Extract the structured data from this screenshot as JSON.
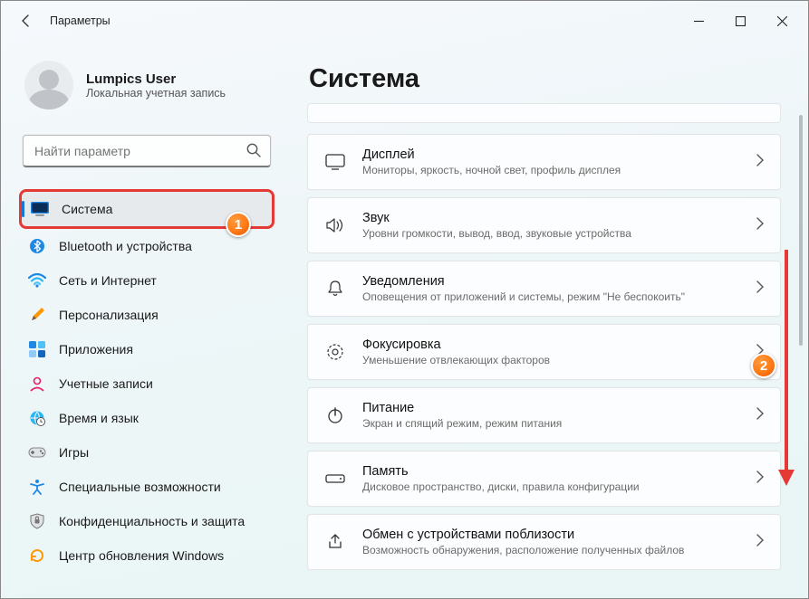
{
  "window": {
    "title": "Параметры"
  },
  "account": {
    "name": "Lumpics User",
    "type": "Локальная учетная запись"
  },
  "search": {
    "placeholder": "Найти параметр"
  },
  "sidebar": {
    "items": [
      {
        "label": "Система"
      },
      {
        "label": "Bluetooth и устройства"
      },
      {
        "label": "Сеть и Интернет"
      },
      {
        "label": "Персонализация"
      },
      {
        "label": "Приложения"
      },
      {
        "label": "Учетные записи"
      },
      {
        "label": "Время и язык"
      },
      {
        "label": "Игры"
      },
      {
        "label": "Специальные возможности"
      },
      {
        "label": "Конфиденциальность и защита"
      },
      {
        "label": "Центр обновления Windows"
      }
    ]
  },
  "main": {
    "title": "Система",
    "cards": [
      {
        "title": "Дисплей",
        "sub": "Мониторы, яркость, ночной свет, профиль дисплея"
      },
      {
        "title": "Звук",
        "sub": "Уровни громкости, вывод, ввод, звуковые устройства"
      },
      {
        "title": "Уведомления",
        "sub": "Оповещения от приложений и системы, режим \"Не беспокоить\""
      },
      {
        "title": "Фокусировка",
        "sub": "Уменьшение отвлекающих факторов"
      },
      {
        "title": "Питание",
        "sub": "Экран и спящий режим, режим питания"
      },
      {
        "title": "Память",
        "sub": "Дисковое пространство, диски, правила конфигурации"
      },
      {
        "title": "Обмен с устройствами поблизости",
        "sub": "Возможность обнаружения, расположение полученных файлов"
      }
    ]
  },
  "annotations": {
    "badge1": "1",
    "badge2": "2"
  }
}
